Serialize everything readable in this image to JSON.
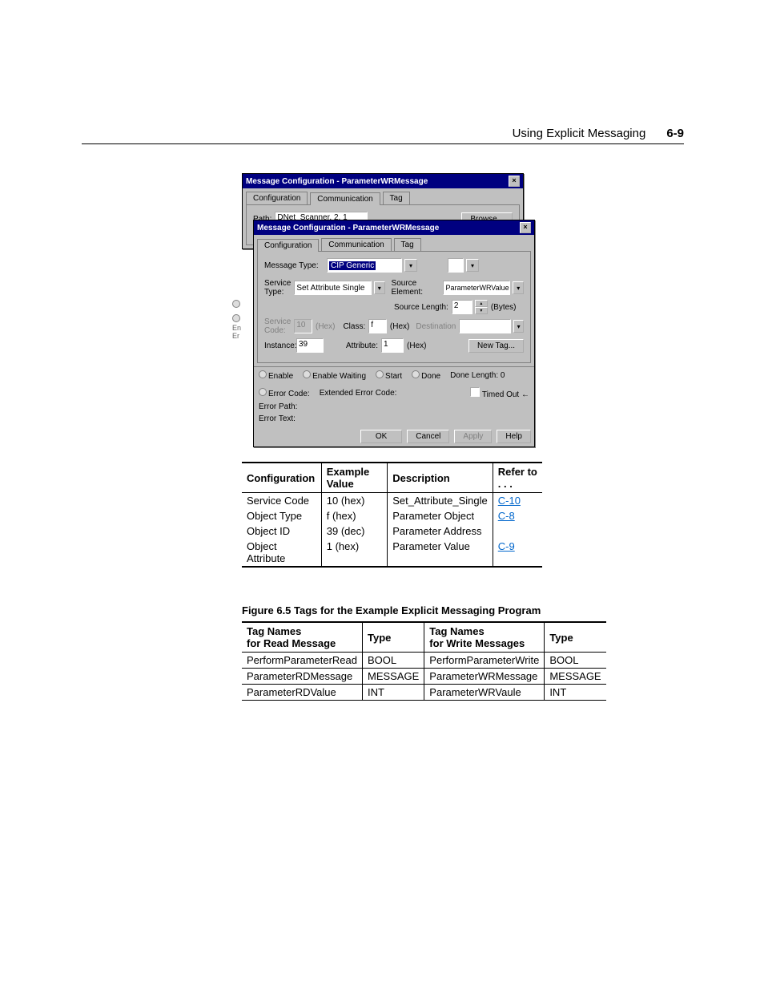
{
  "header": {
    "title": "Using Explicit Messaging",
    "pageNum": "6-9"
  },
  "outerDialog": {
    "title": "Message Configuration - ParameterWRMessage",
    "tabs": {
      "t1": "Configuration",
      "t2": "Communication",
      "t3": "Tag"
    },
    "pathLabel": "Path:",
    "pathValue": "DNet_Scanner, 2, 1",
    "pathHint": "DNet_Scanner, 2, 1",
    "browse": "Browse..."
  },
  "innerDialog": {
    "title": "Message Configuration - ParameterWRMessage",
    "tabs": {
      "t1": "Configuration",
      "t2": "Communication",
      "t3": "Tag"
    },
    "msgTypeLabel": "Message Type:",
    "msgType": "CIP Generic",
    "svcLabel": "Service\nType:",
    "svcType": "Set Attribute Single",
    "srcElemLabel": "Source Element:",
    "srcElem": "ParameterWRValue",
    "srcLenLabel": "Source Length:",
    "srcLen": "2",
    "bytes": "(Bytes)",
    "destLabel": "Destination",
    "svcCodeLabel": "Service\nCode:",
    "svcCode": "10",
    "hex1": "(Hex)",
    "classLabel": "Class:",
    "classVal": "f",
    "hex2": "(Hex)",
    "instLabel": "Instance:",
    "instVal": "39",
    "attrLabel": "Attribute:",
    "attrVal": "1",
    "hex3": "(Hex)",
    "newTag": "New Tag...",
    "enable": "Enable",
    "enableWaiting": "Enable Waiting",
    "start": "Start",
    "done": "Done",
    "doneLen": "Done Length: 0",
    "errCode": "Error Code:",
    "extErr": "Extended Error Code:",
    "timedOut": "Timed Out",
    "errPath": "Error Path:",
    "errText": "Error Text:",
    "ok": "OK",
    "cancel": "Cancel",
    "apply": "Apply",
    "help": "Help"
  },
  "sideLabels": {
    "a": "En",
    "b": "Er"
  },
  "table1": {
    "h1": "Configuration",
    "h2": "Example Value",
    "h3": "Description",
    "h4": "Refer to . . .",
    "r1": {
      "c1": "Service Code",
      "c2": "10 (hex)",
      "c3": "Set_Attribute_Single",
      "c4": "C-10"
    },
    "r2": {
      "c1": "Object Type",
      "c2": "f (hex)",
      "c3": "Parameter Object",
      "c4": "C-8"
    },
    "r3": {
      "c1": "Object ID",
      "c2": "39 (dec)",
      "c3": "Parameter Address",
      "c4": ""
    },
    "r4": {
      "c1": "Object Attribute",
      "c2": "1 (hex)",
      "c3": "Parameter Value",
      "c4": "C-9"
    }
  },
  "figCaption": "Figure 6.5   Tags for the Example Explicit Messaging Program",
  "table2": {
    "h1a": "Tag Names",
    "h1b": "for Read Message",
    "h2": "Type",
    "h3a": "Tag Names",
    "h3b": "for Write Messages",
    "h4": "Type",
    "l": {
      "r1": {
        "c1": "PerformParameterRead",
        "c2": "BOOL"
      },
      "r2": {
        "c1": "ParameterRDMessage",
        "c2": "MESSAGE"
      },
      "r3": {
        "c1": "ParameterRDValue",
        "c2": "INT"
      }
    },
    "r": {
      "r1": {
        "c1": "PerformParameterWrite",
        "c2": "BOOL"
      },
      "r2": {
        "c1": "ParameterWRMessage",
        "c2": "MESSAGE"
      },
      "r3": {
        "c1": "ParameterWRVaule",
        "c2": "INT"
      }
    }
  }
}
